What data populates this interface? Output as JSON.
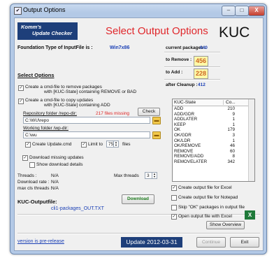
{
  "window": {
    "title": "Output Options",
    "title_icon": "check-icon",
    "buttons": {
      "minimize": "–",
      "maximize": "□",
      "close": "X"
    }
  },
  "header": {
    "logo_line1": "Komm's",
    "logo_line2": "Update Checker",
    "title": "Select Output Options",
    "kuc": "KUC"
  },
  "foundation": {
    "label": "Foundation Type of InputFile is :",
    "value": "Win7x86"
  },
  "stats": {
    "current_label": "current packages :",
    "current_value": "640",
    "remove_label": "to Remove :",
    "remove_value": "456",
    "add_label": "to Add :",
    "add_value": "228",
    "cleanup_label": "after Cleanup :",
    "cleanup_value": "412"
  },
  "select_options": "Select Options",
  "options": {
    "remove_cmd_line1": "Create a cmd-file to remove packages",
    "remove_cmd_line2": "with [KUC-State] containing REMOVE or BAD",
    "copy_cmd_line1": "Create a cmd-file to copy updates",
    "copy_cmd_line2": "with [KUC-State] containing ADD",
    "repo_label": "Repository folder   /repo-dir:",
    "repo_missing": "217 files missing",
    "check_button": "Check",
    "repo_value": "C:\\WU\\repo",
    "working_label": "Working folder     /wp-dir:",
    "working_value": "C:\\wu",
    "create_update_cmd": "Create Update.cmd",
    "limit_to": "Limit to",
    "limit_value": "75",
    "files": "files",
    "download_missing": "Download missing updates",
    "show_download_details": "Show download details"
  },
  "threads": {
    "threads_label": "Threads :",
    "threads_value": "N/A",
    "rate_label": "Download rate :",
    "rate_value": "N/A",
    "max_label": "max cls threads :",
    "max_value": "N/A",
    "max_threads_label": "Max threads",
    "max_threads_value": "3"
  },
  "download_button": "Download",
  "outputfile": {
    "label": "KUC-Outputfile:",
    "value": "cli1-packages_OUT.TXT"
  },
  "list": {
    "col_state": "KUC-State",
    "col_count": "Co...",
    "rows": [
      {
        "state": "ADD",
        "count": "210"
      },
      {
        "state": "ADD/GDR",
        "count": "9"
      },
      {
        "state": "ADDLATER",
        "count": "1"
      },
      {
        "state": "KEEP",
        "count": "1"
      },
      {
        "state": "OK",
        "count": "179"
      },
      {
        "state": "OK/GDR",
        "count": "3"
      },
      {
        "state": "OK/LDR",
        "count": "1"
      },
      {
        "state": "OK/REMOVE",
        "count": "46"
      },
      {
        "state": "REMOVE",
        "count": "60"
      },
      {
        "state": "REMOVE/ADD",
        "count": "8"
      },
      {
        "state": "REMOVELATER",
        "count": "342"
      }
    ]
  },
  "right_options": {
    "excel": "Create output file for Excel",
    "notepad": "Create output file for Notepad",
    "skip_ok": "Skip \"OK\" packages in output file",
    "open_excel": "Open  output file with Excel",
    "show_overview": "Show Overview"
  },
  "footer": {
    "prerelease": "version is pre-release",
    "update": "Update 2012-03-31",
    "continue": "Continue",
    "exit": "Exit"
  },
  "colors": {
    "accent_red": "#e0272b",
    "logo_blue": "#1e3f7a",
    "value_yellow": "#fff9a8"
  }
}
